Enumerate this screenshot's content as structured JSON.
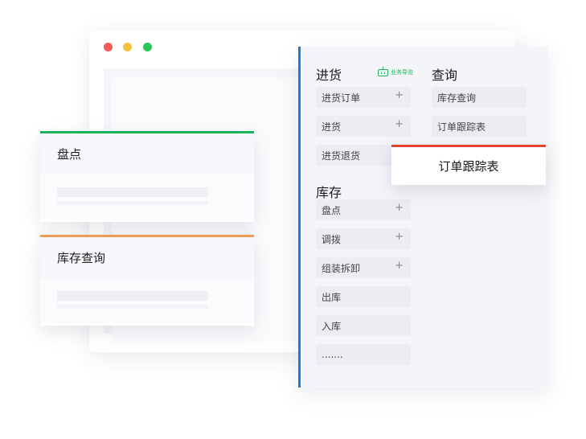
{
  "stocktake_card": {
    "title": "盘点"
  },
  "inventory_card": {
    "title": "库存查询"
  },
  "menu": {
    "purchase": {
      "title": "进货",
      "badge": "业务导览",
      "items": [
        {
          "label": "进货订单",
          "expand": "+"
        },
        {
          "label": "进货",
          "expand": "+"
        },
        {
          "label": "进货退货"
        }
      ]
    },
    "stock": {
      "title": "库存",
      "items": [
        {
          "label": "盘点",
          "expand": "+"
        },
        {
          "label": "调拨",
          "expand": "+"
        },
        {
          "label": "组装拆卸",
          "expand": "+"
        },
        {
          "label": "出库"
        },
        {
          "label": "入库"
        },
        {
          "label": "......."
        }
      ]
    },
    "query": {
      "title": "查询",
      "items": [
        {
          "label": "库存查询"
        },
        {
          "label": "订单跟踪表"
        }
      ]
    }
  },
  "popup": {
    "label": "订单跟踪表"
  },
  "colors": {
    "stocktake_accent": "#1bb35a",
    "inventory_accent": "#ef9c55",
    "menu_accent": "#1a7fd4",
    "popup_accent": "#e2432c"
  }
}
